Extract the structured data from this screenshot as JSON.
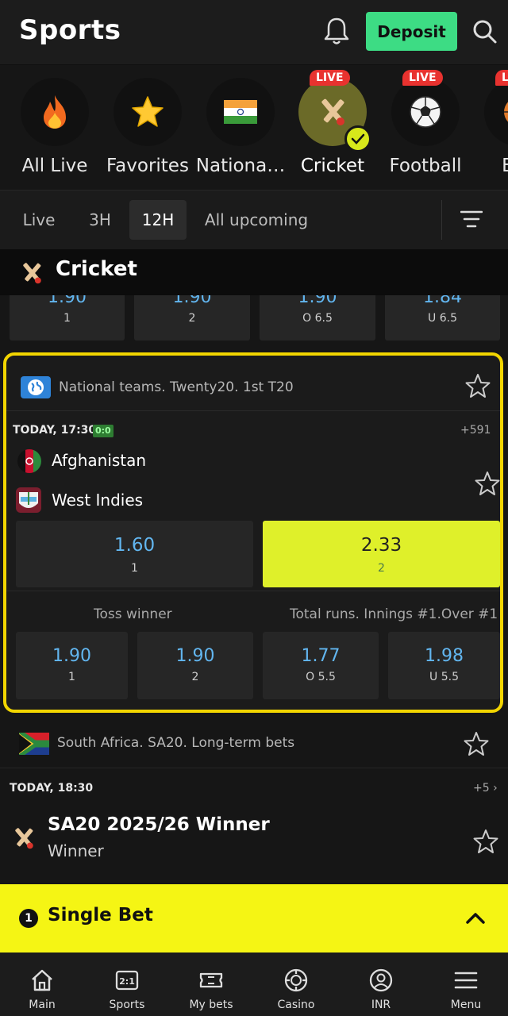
{
  "header": {
    "title": "Sports",
    "deposit_label": "Deposit"
  },
  "sports": [
    {
      "label": "All Live",
      "icon": "fire-icon"
    },
    {
      "label": "Favorites",
      "icon": "star-icon"
    },
    {
      "label": "Nationa…",
      "icon": "india-flag-icon"
    },
    {
      "label": "Cricket",
      "icon": "cricket-icon",
      "live": "LIVE",
      "selected": true
    },
    {
      "label": "Football",
      "icon": "football-icon",
      "live": "LIVE"
    },
    {
      "label": "Bas",
      "icon": "basketball-icon",
      "live": "LI"
    }
  ],
  "timeframes": [
    "Live",
    "3H",
    "12H",
    "All upcoming"
  ],
  "active_timeframe": "12H",
  "section": {
    "title": "Cricket"
  },
  "prev_event_odds": [
    {
      "value": "1.90",
      "label": "1"
    },
    {
      "value": "1.90",
      "label": "2"
    },
    {
      "value": "1.90",
      "label": "O 6.5"
    },
    {
      "value": "1.84",
      "label": "U 6.5"
    }
  ],
  "featured_event": {
    "league": "National teams. Twenty20. 1st T20",
    "date": "TODAY, 17:30",
    "score_badge": "0:0",
    "more_markets": "+591",
    "team1": "Afghanistan",
    "team2": "West Indies",
    "main_odds": [
      {
        "value": "1.60",
        "label": "1"
      },
      {
        "value": "2.33",
        "label": "2",
        "selected": true
      }
    ],
    "market_titles": [
      "Toss winner",
      "Total runs. Innings #1.Over #1"
    ],
    "market_odds": [
      {
        "value": "1.90",
        "label": "1"
      },
      {
        "value": "1.90",
        "label": "2"
      },
      {
        "value": "1.77",
        "label": "O 5.5"
      },
      {
        "value": "1.98",
        "label": "U 5.5"
      }
    ]
  },
  "second_league": {
    "title": "South Africa. SA20. Long-term bets"
  },
  "second_event": {
    "date": "TODAY, 18:30",
    "more": "+5",
    "title": "SA20 2025/26 Winner",
    "subtitle": "Winner"
  },
  "betslip": {
    "count": "1",
    "label": "Single Bet"
  },
  "tabs": [
    {
      "label": "Main",
      "icon": "home-icon"
    },
    {
      "label": "Sports",
      "icon": "scoreboard-icon"
    },
    {
      "label": "My bets",
      "icon": "ticket-icon"
    },
    {
      "label": "Casino",
      "icon": "casino-chip-icon"
    },
    {
      "label": "INR",
      "icon": "user-icon"
    },
    {
      "label": "Menu",
      "icon": "hamburger-icon"
    }
  ],
  "colors": {
    "accent": "#3ddc84",
    "selected_odd": "#dff02a",
    "highlight_border": "#f2d500",
    "betslip": "#f5f514",
    "odd_value": "#62b6f0"
  }
}
